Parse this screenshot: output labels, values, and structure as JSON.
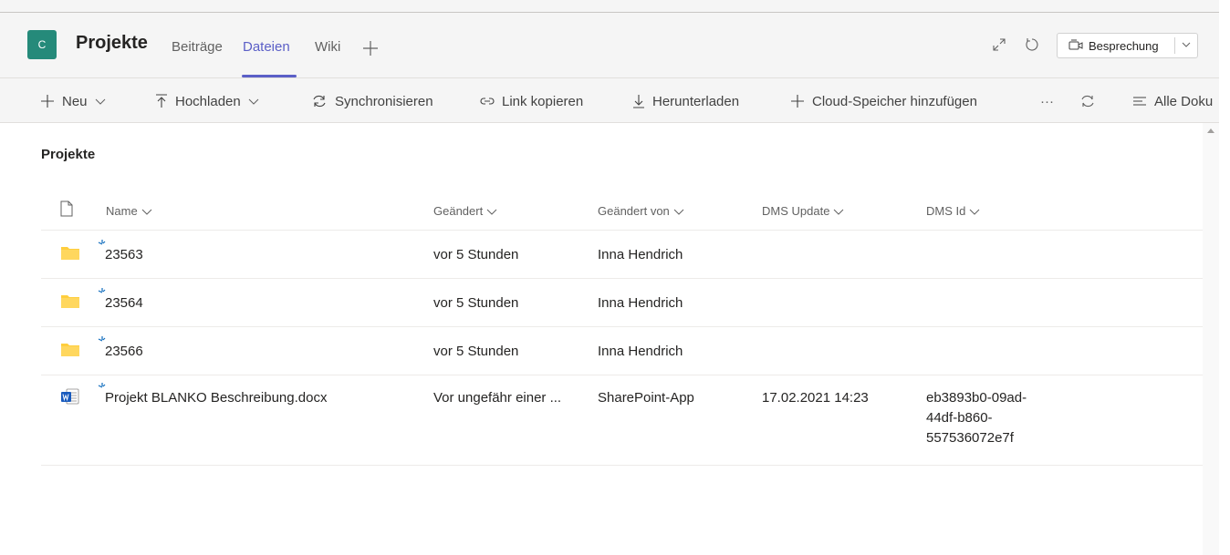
{
  "header": {
    "avatar_letter": "C",
    "channel_title": "Projekte",
    "tabs": [
      {
        "label": "Beiträge",
        "active": false
      },
      {
        "label": "Dateien",
        "active": true
      },
      {
        "label": "Wiki",
        "active": false
      }
    ],
    "meeting_button": "Besprechung",
    "accent_color": "#5b5fc7",
    "avatar_color": "#258a7a"
  },
  "toolbar": {
    "new": "Neu",
    "upload": "Hochladen",
    "sync": "Synchronisieren",
    "copy_link": "Link kopieren",
    "download": "Herunterladen",
    "add_cloud": "Cloud-Speicher hinzufügen",
    "more": "···",
    "all_docs": "Alle Doku"
  },
  "library": {
    "title": "Projekte",
    "columns": {
      "name": "Name",
      "modified": "Geändert",
      "modified_by": "Geändert von",
      "dms_update": "DMS Update",
      "dms_id": "DMS Id"
    },
    "rows": [
      {
        "type": "folder",
        "name": "23563",
        "modified": "vor 5 Stunden",
        "modified_by": "Inna Hendrich",
        "dms_update": "",
        "dms_id": ""
      },
      {
        "type": "folder",
        "name": "23564",
        "modified": "vor 5 Stunden",
        "modified_by": "Inna Hendrich",
        "dms_update": "",
        "dms_id": ""
      },
      {
        "type": "folder",
        "name": "23566",
        "modified": "vor 5 Stunden",
        "modified_by": "Inna Hendrich",
        "dms_update": "",
        "dms_id": ""
      },
      {
        "type": "word-document",
        "name": "Projekt BLANKO Beschreibung.docx",
        "modified": "Vor ungefähr einer ...",
        "modified_by": "SharePoint-App",
        "dms_update": "17.02.2021 14:23",
        "dms_id_lines": [
          "eb3893b0-09ad-",
          "44df-b860-",
          "557536072e7f"
        ]
      }
    ]
  }
}
